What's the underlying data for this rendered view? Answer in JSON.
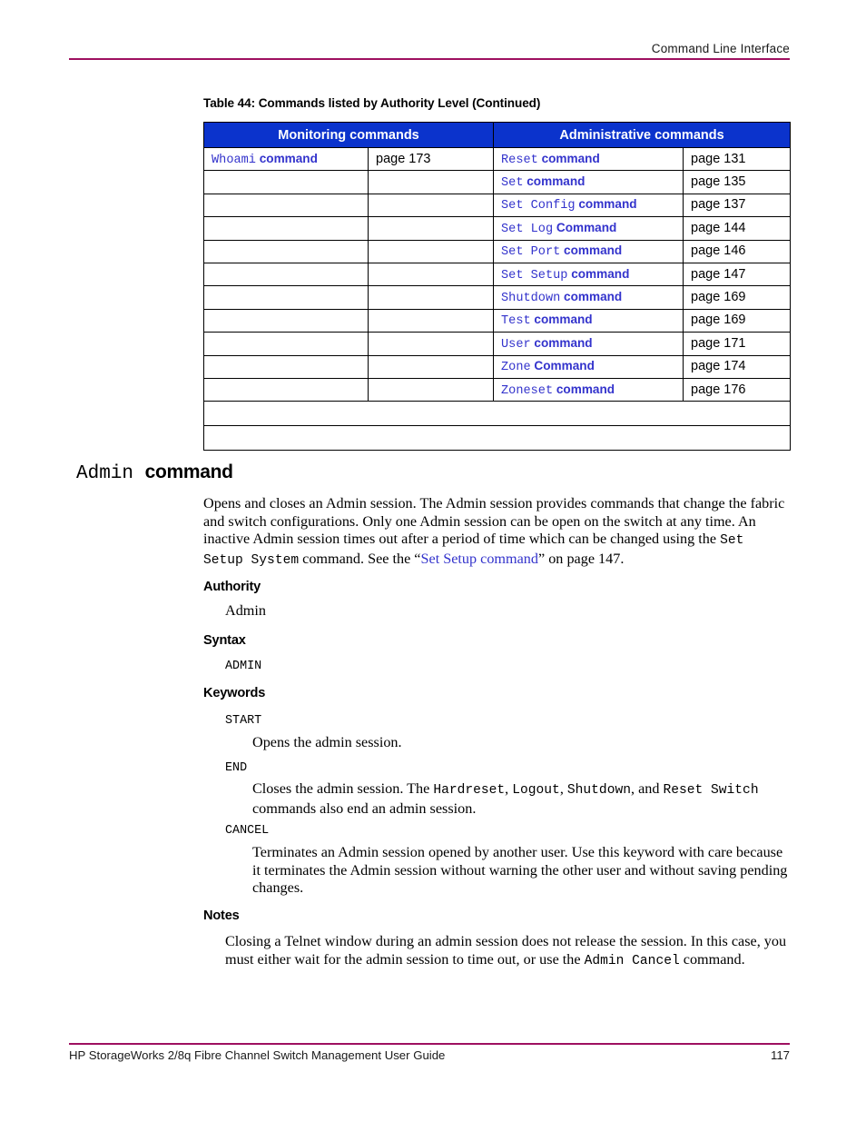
{
  "header": {
    "running_title": "Command Line Interface",
    "rule_color": "#9E1060"
  },
  "table": {
    "caption": "Table 44:  Commands listed by Authority Level (Continued)",
    "header_bg": "#0B33CC",
    "link_color": "#3333CC",
    "columns": [
      {
        "label": "Monitoring commands",
        "span": 2
      },
      {
        "label": "Administrative commands",
        "span": 2
      }
    ],
    "rows": [
      {
        "mon_cmd_mono": "Whoami",
        "mon_cmd_word": "command",
        "mon_page": "page 173",
        "adm_cmd_mono": "Reset",
        "adm_cmd_word": "command",
        "adm_page": "page 131"
      },
      {
        "mon_cmd_mono": "",
        "mon_cmd_word": "",
        "mon_page": "",
        "adm_cmd_mono": "Set",
        "adm_cmd_word": "command",
        "adm_page": "page 135"
      },
      {
        "mon_cmd_mono": "",
        "mon_cmd_word": "",
        "mon_page": "",
        "adm_cmd_mono": "Set Config",
        "adm_cmd_word": "command",
        "adm_page": "page 137"
      },
      {
        "mon_cmd_mono": "",
        "mon_cmd_word": "",
        "mon_page": "",
        "adm_cmd_mono": "Set Log",
        "adm_cmd_word": "Command",
        "adm_page": "page 144"
      },
      {
        "mon_cmd_mono": "",
        "mon_cmd_word": "",
        "mon_page": "",
        "adm_cmd_mono": "Set Port",
        "adm_cmd_word": "command",
        "adm_page": "page 146"
      },
      {
        "mon_cmd_mono": "",
        "mon_cmd_word": "",
        "mon_page": "",
        "adm_cmd_mono": "Set Setup",
        "adm_cmd_word": "command",
        "adm_page": "page 147"
      },
      {
        "mon_cmd_mono": "",
        "mon_cmd_word": "",
        "mon_page": "",
        "adm_cmd_mono": "Shutdown",
        "adm_cmd_word": "command",
        "adm_page": "page 169"
      },
      {
        "mon_cmd_mono": "",
        "mon_cmd_word": "",
        "mon_page": "",
        "adm_cmd_mono": "Test",
        "adm_cmd_word": "command",
        "adm_page": "page 169"
      },
      {
        "mon_cmd_mono": "",
        "mon_cmd_word": "",
        "mon_page": "",
        "adm_cmd_mono": "User",
        "adm_cmd_word": "command",
        "adm_page": "page 171"
      },
      {
        "mon_cmd_mono": "",
        "mon_cmd_word": "",
        "mon_page": "",
        "adm_cmd_mono": "Zone",
        "adm_cmd_word": "Command",
        "adm_page": "page 174"
      },
      {
        "mon_cmd_mono": "",
        "mon_cmd_word": "",
        "mon_page": "",
        "adm_cmd_mono": "Zoneset",
        "adm_cmd_word": "command",
        "adm_page": "page 176"
      }
    ],
    "trailing_blank_rows": 2
  },
  "section": {
    "heading_mono": "Admin",
    "heading_word": "command",
    "intro": {
      "part1": "Opens and closes an Admin session. The Admin session provides commands that change the fabric and switch configurations. Only one Admin session can be open on the switch at any time. An inactive Admin session times out after a period of time which can be changed using the ",
      "code1": "Set Setup System",
      "part2": " command. See the “",
      "xref": "Set Setup command",
      "part3": "” on page 147."
    },
    "authority": {
      "label": "Authority",
      "value": "Admin"
    },
    "syntax": {
      "label": "Syntax",
      "value": "ADMIN"
    },
    "keywords": {
      "label": "Keywords",
      "items": [
        {
          "term": "START",
          "def_part1": "Opens the admin session.",
          "code1": "",
          "def_part2": "",
          "code2": "",
          "def_part3": "",
          "code3": "",
          "def_part4": "",
          "code4": "",
          "def_part5": ""
        },
        {
          "term": "END",
          "def_part1": "Closes the admin session. The ",
          "code1": "Hardreset",
          "def_part2": ", ",
          "code2": "Logout",
          "def_part3": ", ",
          "code3": "Shutdown",
          "def_part4": ", and ",
          "code4": "Reset Switch",
          "def_part5": " commands also end an admin session."
        },
        {
          "term": "CANCEL",
          "def_part1": "Terminates an Admin session opened by another user. Use this keyword with care because it terminates the Admin session without warning the other user and without saving pending changes.",
          "code1": "",
          "def_part2": "",
          "code2": "",
          "def_part3": "",
          "code3": "",
          "def_part4": "",
          "code4": "",
          "def_part5": ""
        }
      ]
    },
    "notes": {
      "label": "Notes",
      "part1": "Closing a Telnet window during an admin session does not release the session. In this case, you must either wait for the admin session to time out, or use the ",
      "code1": "Admin Cancel",
      "part2": " command."
    }
  },
  "footer": {
    "guide_title": "HP StorageWorks 2/8q Fibre Channel Switch Management User Guide",
    "page_number": "117"
  }
}
